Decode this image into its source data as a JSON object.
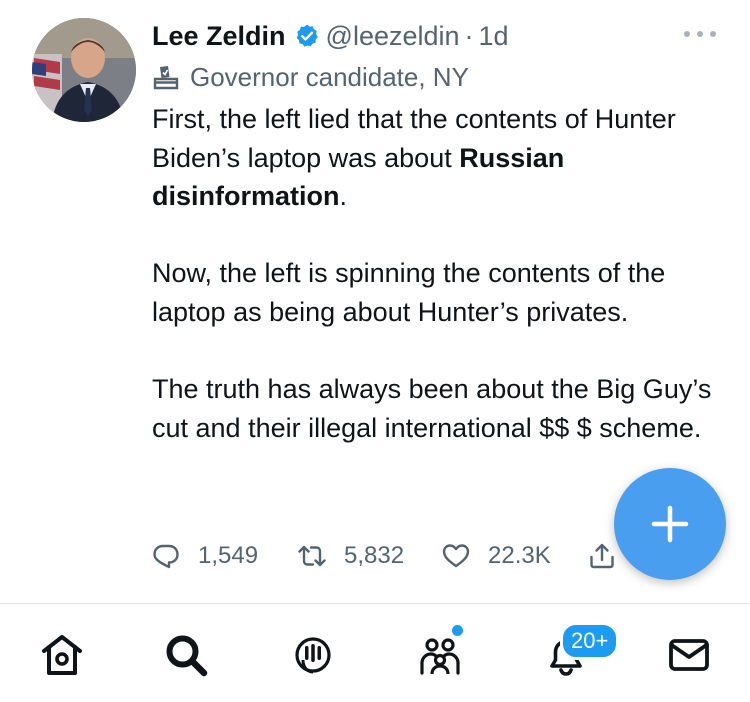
{
  "tweet": {
    "author_name": "Lee Zeldin",
    "handle": "@leezeldin",
    "separator": "·",
    "time": "1d",
    "label": "Governor candidate, NY",
    "body_1": "First, the left lied that the contents of Hunter Biden’s laptop was about ",
    "body_bold": "Russian disinformation",
    "body_2": ".\n\nNow, the left is spinning the contents of the laptop as being about Hunter’s privates.\n\nThe truth has always been about the Big Guy’s cut and their illegal international $$ $ scheme.",
    "counts": {
      "replies": "1,549",
      "retweets": "5,832",
      "likes": "22.3K"
    }
  },
  "tabbar": {
    "notifications_badge": "20+"
  },
  "icons": {
    "verified": "verified-badge-icon",
    "more": "more-icon",
    "label": "ballot-box-icon",
    "reply": "reply-icon",
    "retweet": "retweet-icon",
    "like": "heart-icon",
    "share": "share-icon",
    "compose": "plus-icon",
    "home": "home-icon",
    "search": "search-icon",
    "spaces": "spaces-icon",
    "communities": "communities-icon",
    "notifications": "bell-icon",
    "messages": "mail-icon"
  },
  "colors": {
    "accent": "#1d9bf0",
    "fab": "#4a9ef0",
    "text": "#0f1419",
    "muted": "#536471"
  }
}
